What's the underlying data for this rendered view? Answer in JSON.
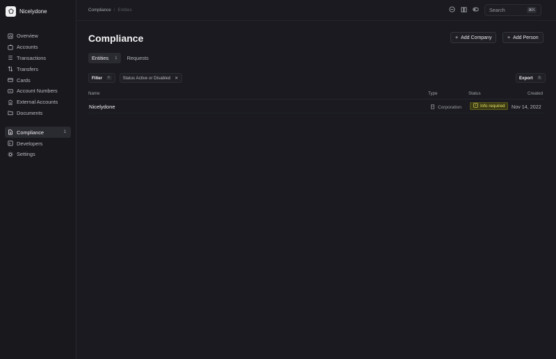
{
  "app": {
    "name": "Nicelydone"
  },
  "sidebar": {
    "items": [
      {
        "label": "Overview"
      },
      {
        "label": "Accounts"
      },
      {
        "label": "Transactions"
      },
      {
        "label": "Transfers"
      },
      {
        "label": "Cards"
      },
      {
        "label": "Account Numbers"
      },
      {
        "label": "External Accounts"
      },
      {
        "label": "Documents"
      }
    ],
    "secondary": [
      {
        "label": "Compliance",
        "count": "1",
        "active": true
      },
      {
        "label": "Developers"
      },
      {
        "label": "Settings"
      }
    ]
  },
  "breadcrumb": {
    "parent": "Compliance",
    "separator": "/",
    "current": "Entities"
  },
  "search": {
    "placeholder": "Search",
    "shortcut": "⌘K"
  },
  "page": {
    "title": "Compliance",
    "add_company": "Add Company",
    "add_person": "Add Person"
  },
  "tabs": [
    {
      "label": "Entities",
      "count": "1",
      "active": true
    },
    {
      "label": "Requests"
    }
  ],
  "filters": {
    "filter_label": "Filter",
    "filter_key": "F",
    "status_chip": "Status Active or Disabled",
    "export_label": "Export",
    "export_key": "E"
  },
  "table": {
    "columns": [
      "Name",
      "Type",
      "Status",
      "Created"
    ],
    "rows": [
      {
        "name": "Nicelydone",
        "type": "Corporation",
        "status": "Info required",
        "created": "Nov 14, 2022"
      }
    ]
  },
  "colors": {
    "background": "#1a1a20",
    "status_warning": "#e7e261"
  }
}
